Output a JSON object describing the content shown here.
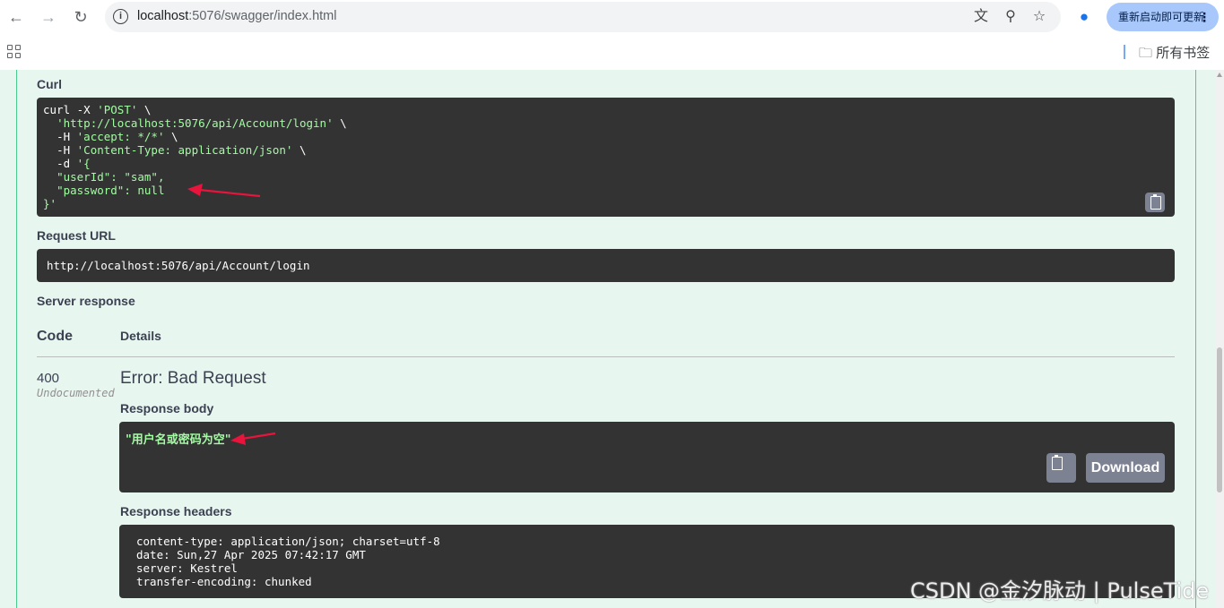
{
  "browser": {
    "url_host": "localhost",
    "url_path": ":5076/swagger/index.html",
    "update_label": "重新启动即可更新",
    "bookmarks_folder": "所有书签"
  },
  "curl": {
    "label": "Curl",
    "command_line": "curl -X ",
    "method": "'POST'",
    "line1_end": " \\",
    "url": "'http://localhost:5076/api/Account/login'",
    "h1_prefix": "-H ",
    "h1": "'accept: */*'",
    "h2_prefix": "-H ",
    "h2": "'Content-Type: application/json'",
    "d_prefix": "-d ",
    "d_open": "'{",
    "body_user": "\"userId\": \"sam\",",
    "body_password": "\"password\": null",
    "body_close": "}'"
  },
  "request_url": {
    "label": "Request URL",
    "value": "http://localhost:5076/api/Account/login"
  },
  "server_response": {
    "label": "Server response",
    "col_code": "Code",
    "col_details": "Details",
    "code": "400",
    "code_note": "Undocumented",
    "error_title": "Error: Bad Request",
    "body_label": "Response body",
    "body_value": "\"用户名或密码为空\"",
    "download_label": "Download",
    "headers_label": "Response headers",
    "headers": [
      "content-type: application/json; charset=utf-8",
      "date: Sun,27 Apr 2025 07:42:17 GMT",
      "server: Kestrel",
      "transfer-encoding: chunked"
    ]
  },
  "watermark": "CSDN @金汐脉动 | PulseTide",
  "colors": {
    "accent": "#49cc90",
    "code_bg": "#333333",
    "string_green": "#a2fca2",
    "arrow_red": "#e8143c"
  }
}
